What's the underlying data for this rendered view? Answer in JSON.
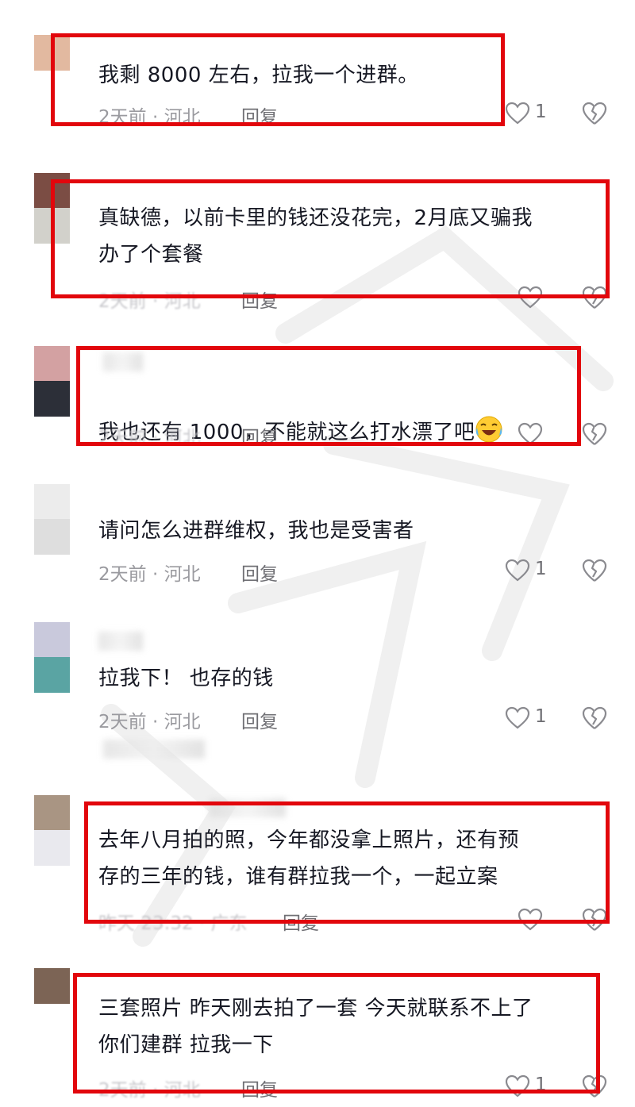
{
  "comments": [
    {
      "text": "我剩 8000 左右，拉我一个进群。",
      "meta": "2天前 · 河北",
      "reply": "回复",
      "likes": "1",
      "avatar_colors": [
        "#e2b9a0",
        "#ffffff"
      ]
    },
    {
      "text": "真缺德，以前卡里的钱还没花完，2月底又骗我\n办了个套餐",
      "meta": "2天前 · 河北",
      "reply": "回复",
      "likes": "",
      "avatar_colors": [
        "#7b4d44",
        "#d2d1cb"
      ]
    },
    {
      "text": "我也还有 1000，不能就这么打水漂了吧",
      "meta": "2天前 · 河北",
      "reply": "回复",
      "likes": "",
      "emoji": "laughing-crying-emoji",
      "avatar_colors": [
        "#d3a1a2",
        "#2c2f38"
      ]
    },
    {
      "text": "请问怎么进群维权，我也是受害者",
      "meta": "2天前 · 河北",
      "reply": "回复",
      "likes": "1",
      "avatar_colors": [
        "#ececec",
        "#dedede"
      ]
    },
    {
      "text": "拉我下！ 也存的钱",
      "meta": "2天前 · 河北",
      "reply": "回复",
      "likes": "1",
      "avatar_colors": [
        "#c9c9dc",
        "#5aa4a3"
      ]
    },
    {
      "text": "去年八月拍的照，今年都没拿上照片，还有预\n存的三年的钱，谁有群拉我一个，一起立案",
      "meta": "昨天 23:32 · 广东",
      "reply": "回复",
      "likes": "",
      "avatar_colors": [
        "#a99583",
        "#e9e9ee"
      ]
    },
    {
      "text": "三套照片 昨天刚去拍了一套 今天就联系不上了\n你们建群 拉我一下",
      "meta": "2天前 · 河北",
      "reply": "回复",
      "likes": "1",
      "avatar_colors": [
        "#7c6455",
        "#ffffff"
      ]
    }
  ],
  "icons": {
    "like": "heart-outline-icon",
    "dislike": "broken-heart-icon"
  },
  "colors": {
    "highlight_box": "#e2060c",
    "meta_text": "#9a9a9f",
    "body_text": "#161823"
  }
}
